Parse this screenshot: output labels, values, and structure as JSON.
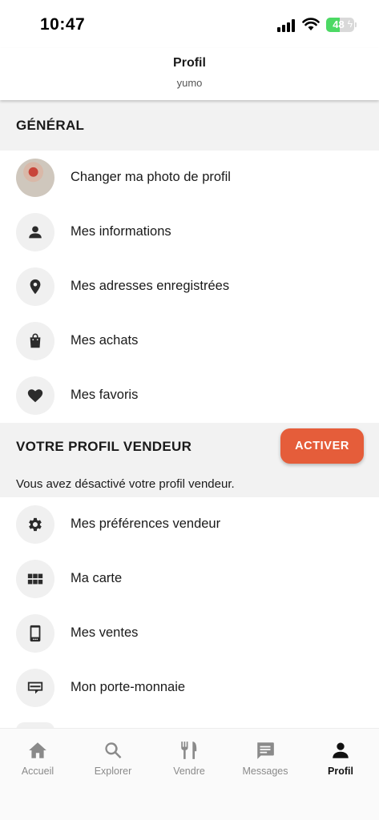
{
  "status_bar": {
    "time": "10:47",
    "battery": "48",
    "battery_level": 0.48
  },
  "header": {
    "title": "Profil",
    "subtitle": "yumo"
  },
  "general": {
    "title": "GÉNÉRAL",
    "items": [
      {
        "label": "Changer ma photo de profil",
        "icon": "avatar"
      },
      {
        "label": "Mes informations",
        "icon": "person-icon"
      },
      {
        "label": "Mes adresses enregistrées",
        "icon": "location-pin-icon"
      },
      {
        "label": "Mes achats",
        "icon": "shopping-bag-icon"
      },
      {
        "label": "Mes favoris",
        "icon": "heart-icon"
      }
    ]
  },
  "vendor": {
    "title": "VOTRE PROFIL VENDEUR",
    "activate_label": "ACTIVER",
    "note": "Vous avez désactivé votre profil vendeur.",
    "items": [
      {
        "label": "Mes préférences vendeur",
        "icon": "gear-icon"
      },
      {
        "label": "Ma carte",
        "icon": "grid-icon"
      },
      {
        "label": "Mes ventes",
        "icon": "phone-icon"
      },
      {
        "label": "Mon porte-monnaie",
        "icon": "wallet-icon"
      }
    ]
  },
  "tabs": [
    {
      "label": "Accueil",
      "icon": "home-icon",
      "active": false
    },
    {
      "label": "Explorer",
      "icon": "search-icon",
      "active": false
    },
    {
      "label": "Vendre",
      "icon": "fork-knife-icon",
      "active": false
    },
    {
      "label": "Messages",
      "icon": "message-icon",
      "active": false
    },
    {
      "label": "Profil",
      "icon": "person-icon",
      "active": true
    }
  ],
  "colors": {
    "accent": "#e55d3a",
    "section_bg": "#f2f2f2",
    "icon_bg": "#f0f0f0",
    "battery_green": "#4cd964"
  }
}
